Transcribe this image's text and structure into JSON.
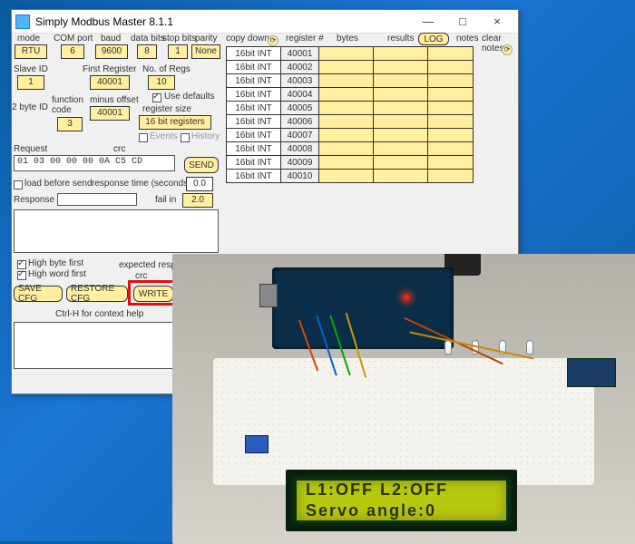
{
  "window": {
    "title": "Simply Modbus Master 8.1.1",
    "minimize": "—",
    "maximize": "□",
    "close": "×"
  },
  "topRow": {
    "mode_lbl": "mode",
    "mode": "RTU",
    "com_lbl": "COM port",
    "com": "6",
    "baud_lbl": "baud",
    "baud": "9600",
    "data_lbl": "data bits",
    "data": "8",
    "stop_lbl": "stop bits",
    "stop": "1",
    "parity_lbl": "parity",
    "parity": "None"
  },
  "row2": {
    "slave_lbl": "Slave ID",
    "slave": "1",
    "first_lbl": "First Register",
    "first": "40001",
    "nregs_lbl": "No. of Regs",
    "nregs": "10"
  },
  "row3": {
    "byteid_lbl": "2 byte ID",
    "func_lbl": "function\ncode",
    "func": "3",
    "minus_lbl": "minus offset",
    "minus": "40001",
    "regsize_lbl": "register size",
    "regsize": "16 bit registers",
    "defaults": "Use defaults",
    "events": "Events",
    "history": "History"
  },
  "request": {
    "lbl": "Request",
    "crc": "crc",
    "bytes": "01 03 00 00 00 0A C5 CD",
    "send": "SEND"
  },
  "opts": {
    "load": "load before send",
    "rt_lbl": "response time (seconds)",
    "rt": "0.0",
    "resp_lbl": "Response",
    "fail_lbl": "fail in",
    "fail": "2.0",
    "hb": "High byte first",
    "hw": "High word first",
    "exp": "expected resp",
    "save": "SAVE CFG",
    "restore": "RESTORE CFG",
    "write": "WRITE",
    "ctx": "Ctrl-H for context help"
  },
  "gridHead": {
    "copy": "copy down",
    "reg": "register #",
    "bytes": "bytes",
    "results": "results",
    "log": "LOG",
    "notes": "notes",
    "clear": "clear notes"
  },
  "registers": [
    {
      "type": "16bit INT",
      "reg": "40001"
    },
    {
      "type": "16bit INT",
      "reg": "40002"
    },
    {
      "type": "16bit INT",
      "reg": "40003"
    },
    {
      "type": "16bit INT",
      "reg": "40004"
    },
    {
      "type": "16bit INT",
      "reg": "40005"
    },
    {
      "type": "16bit INT",
      "reg": "40006"
    },
    {
      "type": "16bit INT",
      "reg": "40007"
    },
    {
      "type": "16bit INT",
      "reg": "40008"
    },
    {
      "type": "16bit INT",
      "reg": "40009"
    },
    {
      "type": "16bit INT",
      "reg": "40010"
    }
  ],
  "lcd": {
    "line1": "L1:OFF  L2:OFF",
    "line2": "Servo angle:0"
  }
}
